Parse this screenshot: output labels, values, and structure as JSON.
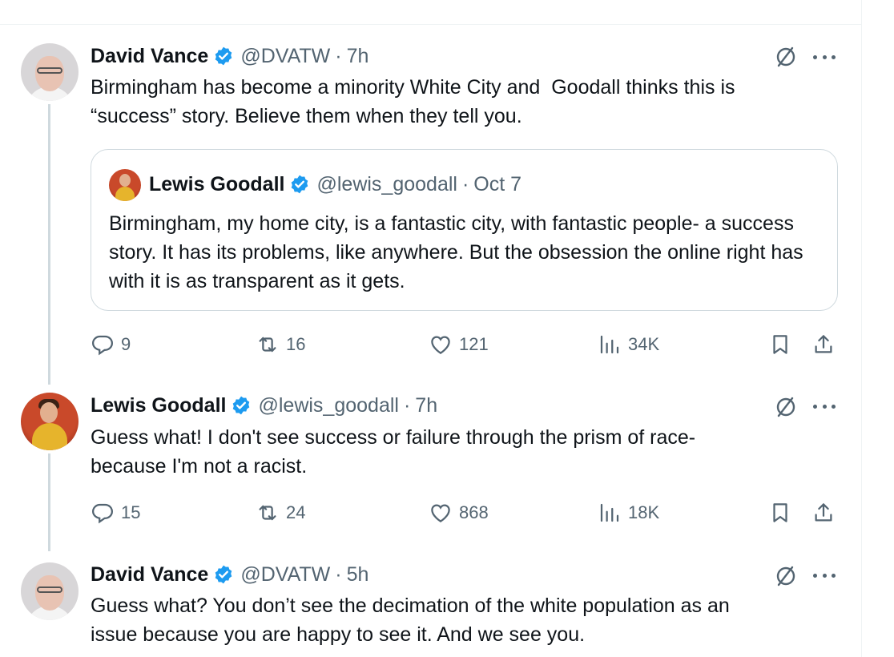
{
  "colors": {
    "text": "#0f1419",
    "secondary": "#536471",
    "verified": "#1d9bf0",
    "border": "#cfd9de",
    "thread_line": "#cfd9de"
  },
  "icons": {
    "reply": "reply-icon",
    "retweet": "retweet-icon",
    "like": "heart-icon",
    "views": "views-icon",
    "bookmark": "bookmark-icon",
    "share": "share-icon",
    "grok": "grok-icon",
    "more": "more-icon",
    "verified": "verified-badge-icon"
  },
  "tweets": [
    {
      "name": "David Vance",
      "handle": "@DVATW",
      "sep": "·",
      "time": "7h",
      "text": "Birmingham has become a minority White City and  Goodall thinks this is\n“success” story. Believe them when they tell you.",
      "quote": {
        "name": "Lewis Goodall",
        "handle": "@lewis_goodall",
        "sep": "·",
        "time": "Oct 7",
        "text": "Birmingham, my home city, is a fantastic city, with fantastic people- a success story. It has its problems, like anywhere. But the obsession the online right has with it is as transparent as it gets."
      },
      "stats": {
        "replies": "9",
        "retweets": "16",
        "likes": "121",
        "views": "34K"
      }
    },
    {
      "name": "Lewis Goodall",
      "handle": "@lewis_goodall",
      "sep": "·",
      "time": "7h",
      "text": "Guess what! I don't see success or failure through the prism of race-\nbecause I'm not a racist.",
      "stats": {
        "replies": "15",
        "retweets": "24",
        "likes": "868",
        "views": "18K"
      }
    },
    {
      "name": "David Vance",
      "handle": "@DVATW",
      "sep": "·",
      "time": "5h",
      "text": "Guess what? You don’t see the decimation of the white population as an\nissue because you are happy to see it. And we see you."
    }
  ]
}
